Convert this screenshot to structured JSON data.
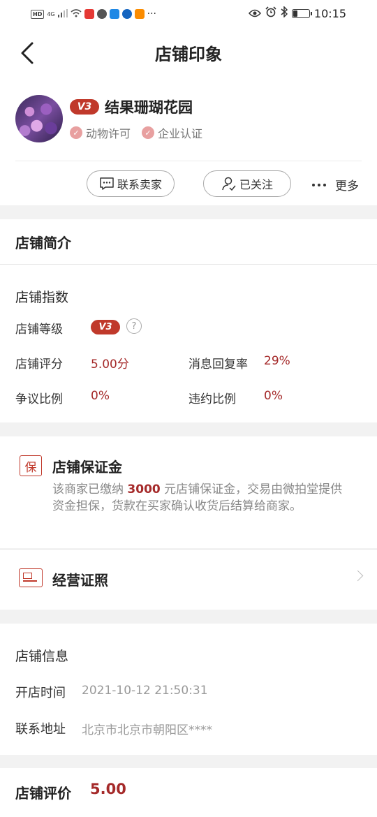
{
  "status_bar": {
    "left_text": "HD",
    "signal": "4G",
    "more": "···",
    "time": "10:15"
  },
  "nav": {
    "title": "店铺印象"
  },
  "shop": {
    "level_badge": "V3",
    "name": "结果珊瑚花园",
    "certifications": [
      "动物许可",
      "企业认证"
    ],
    "contact_button": "联系卖家",
    "follow_button": "已关注",
    "more_label": "更多"
  },
  "intro": {
    "heading": "店铺简介"
  },
  "index": {
    "heading": "店铺指数",
    "level_label": "店铺等级",
    "level_badge": "V3",
    "help": "?",
    "score_label": "店铺评分",
    "score_value": "5.00分",
    "reply_label": "消息回复率",
    "reply_value": "29%",
    "dispute_label": "争议比例",
    "dispute_value": "0%",
    "breach_label": "违约比例",
    "breach_value": "0%"
  },
  "deposit": {
    "icon_char": "保",
    "title": "店铺保证金",
    "text_before": "该商家已缴纳 ",
    "amount": "3000",
    "text_after": " 元店铺保证金，交易由微拍堂提供资金担保，货款在买家确认收货后结算给商家。"
  },
  "license": {
    "title": "经营证照"
  },
  "shop_info": {
    "heading": "店铺信息",
    "open_time_label": "开店时间",
    "open_time_value": "2021-10-12 21:50:31",
    "address_label": "联系地址",
    "address_value": "北京市北京市朝阳区****"
  },
  "rating": {
    "heading": "店铺评价",
    "score": "5.00"
  },
  "colors": {
    "accent": "#c0392b",
    "value_red": "#a52a2a"
  }
}
